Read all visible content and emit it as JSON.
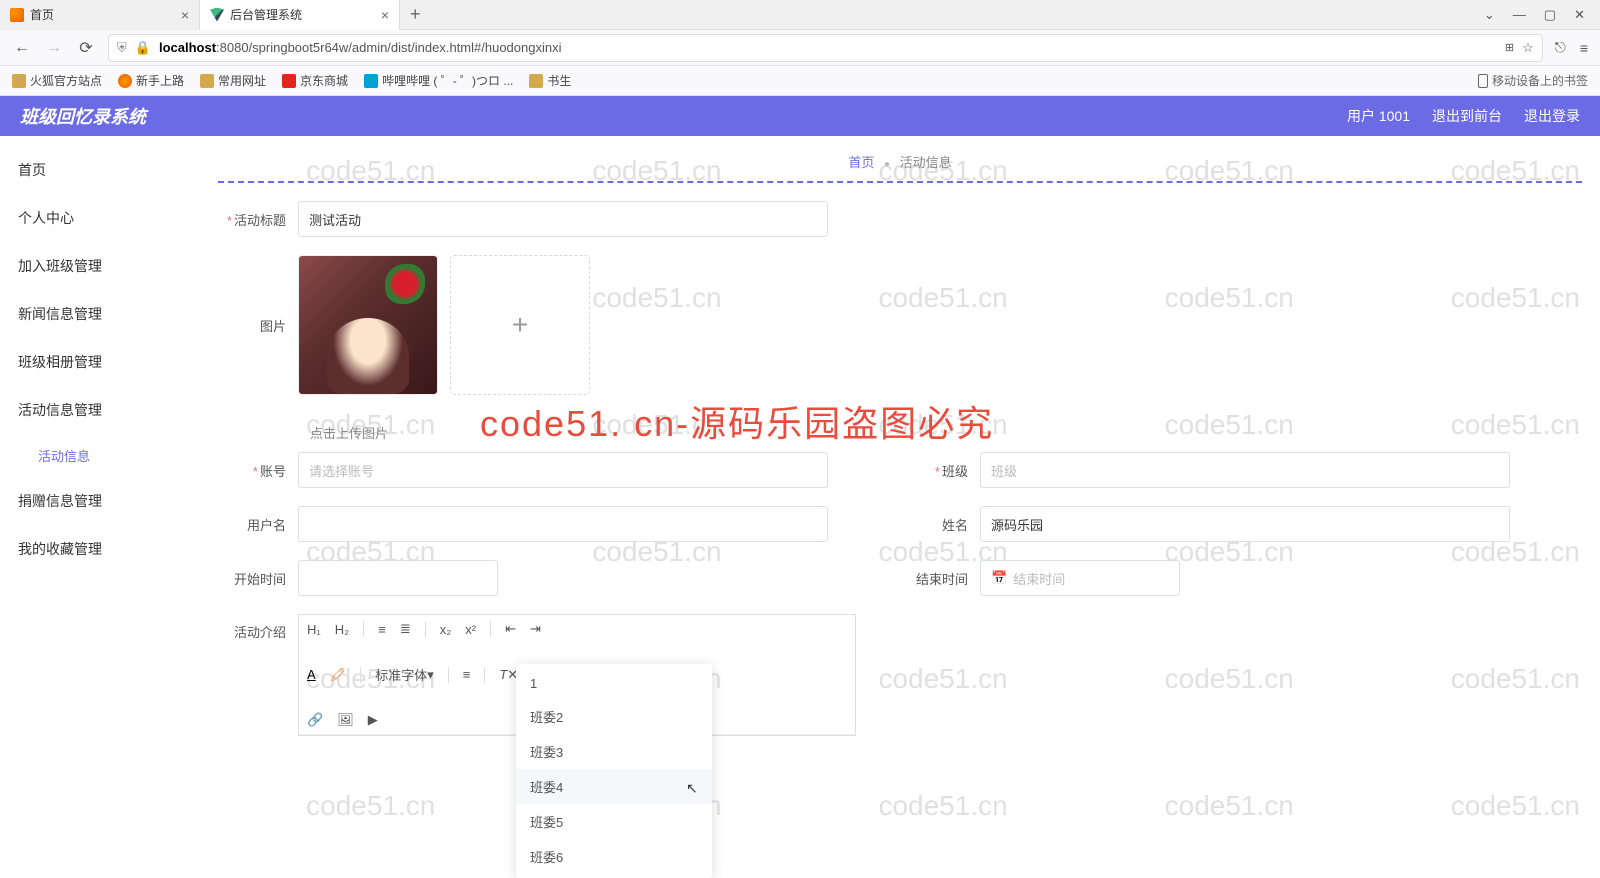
{
  "browser": {
    "tabs": [
      {
        "label": "首页"
      },
      {
        "label": "后台管理系统"
      }
    ],
    "url_host": "localhost",
    "url_rest": ":8080/springboot5r64w/admin/dist/index.html#/huodongxinxi",
    "win": {
      "min": "—",
      "max": "▢",
      "close": "✕",
      "down": "⌄"
    }
  },
  "bookmarks": {
    "items": [
      "火狐官方站点",
      "新手上路",
      "常用网址",
      "京东商城",
      "哔哩哔哩 ( ゜- ゜)つロ ...",
      "书生"
    ],
    "mobile": "移动设备上的书签"
  },
  "app": {
    "title": "班级回忆录系统",
    "user": "用户 1001",
    "exit_front": "退出到前台",
    "logout": "退出登录"
  },
  "sidebar": {
    "items": [
      "首页",
      "个人中心",
      "加入班级管理",
      "新闻信息管理",
      "班级相册管理",
      "活动信息管理",
      "捐赠信息管理",
      "我的收藏管理"
    ],
    "sub": "活动信息"
  },
  "breadcrumb": {
    "home": "首页",
    "current": "活动信息"
  },
  "form": {
    "title_label": "活动标题",
    "title_value": "测试活动",
    "image_label": "图片",
    "upload_hint": "点击上传图片",
    "account_label": "账号",
    "account_ph": "请选择账号",
    "class_label": "班级",
    "class_ph": "班级",
    "username_label": "用户名",
    "name_label": "姓名",
    "name_value": "源码乐园",
    "start_label": "开始时间",
    "end_label": "结束时间",
    "end_ph": "结束时间",
    "intro_label": "活动介绍"
  },
  "dropdown": {
    "items": [
      "1",
      "班委2",
      "班委3",
      "班委4",
      "班委5",
      "班委6"
    ],
    "hover_index": 3
  },
  "editor": {
    "font_label": "标准字体"
  },
  "watermark": {
    "text": "code51.cn",
    "big": "code51. cn-源码乐园盗图必究"
  }
}
